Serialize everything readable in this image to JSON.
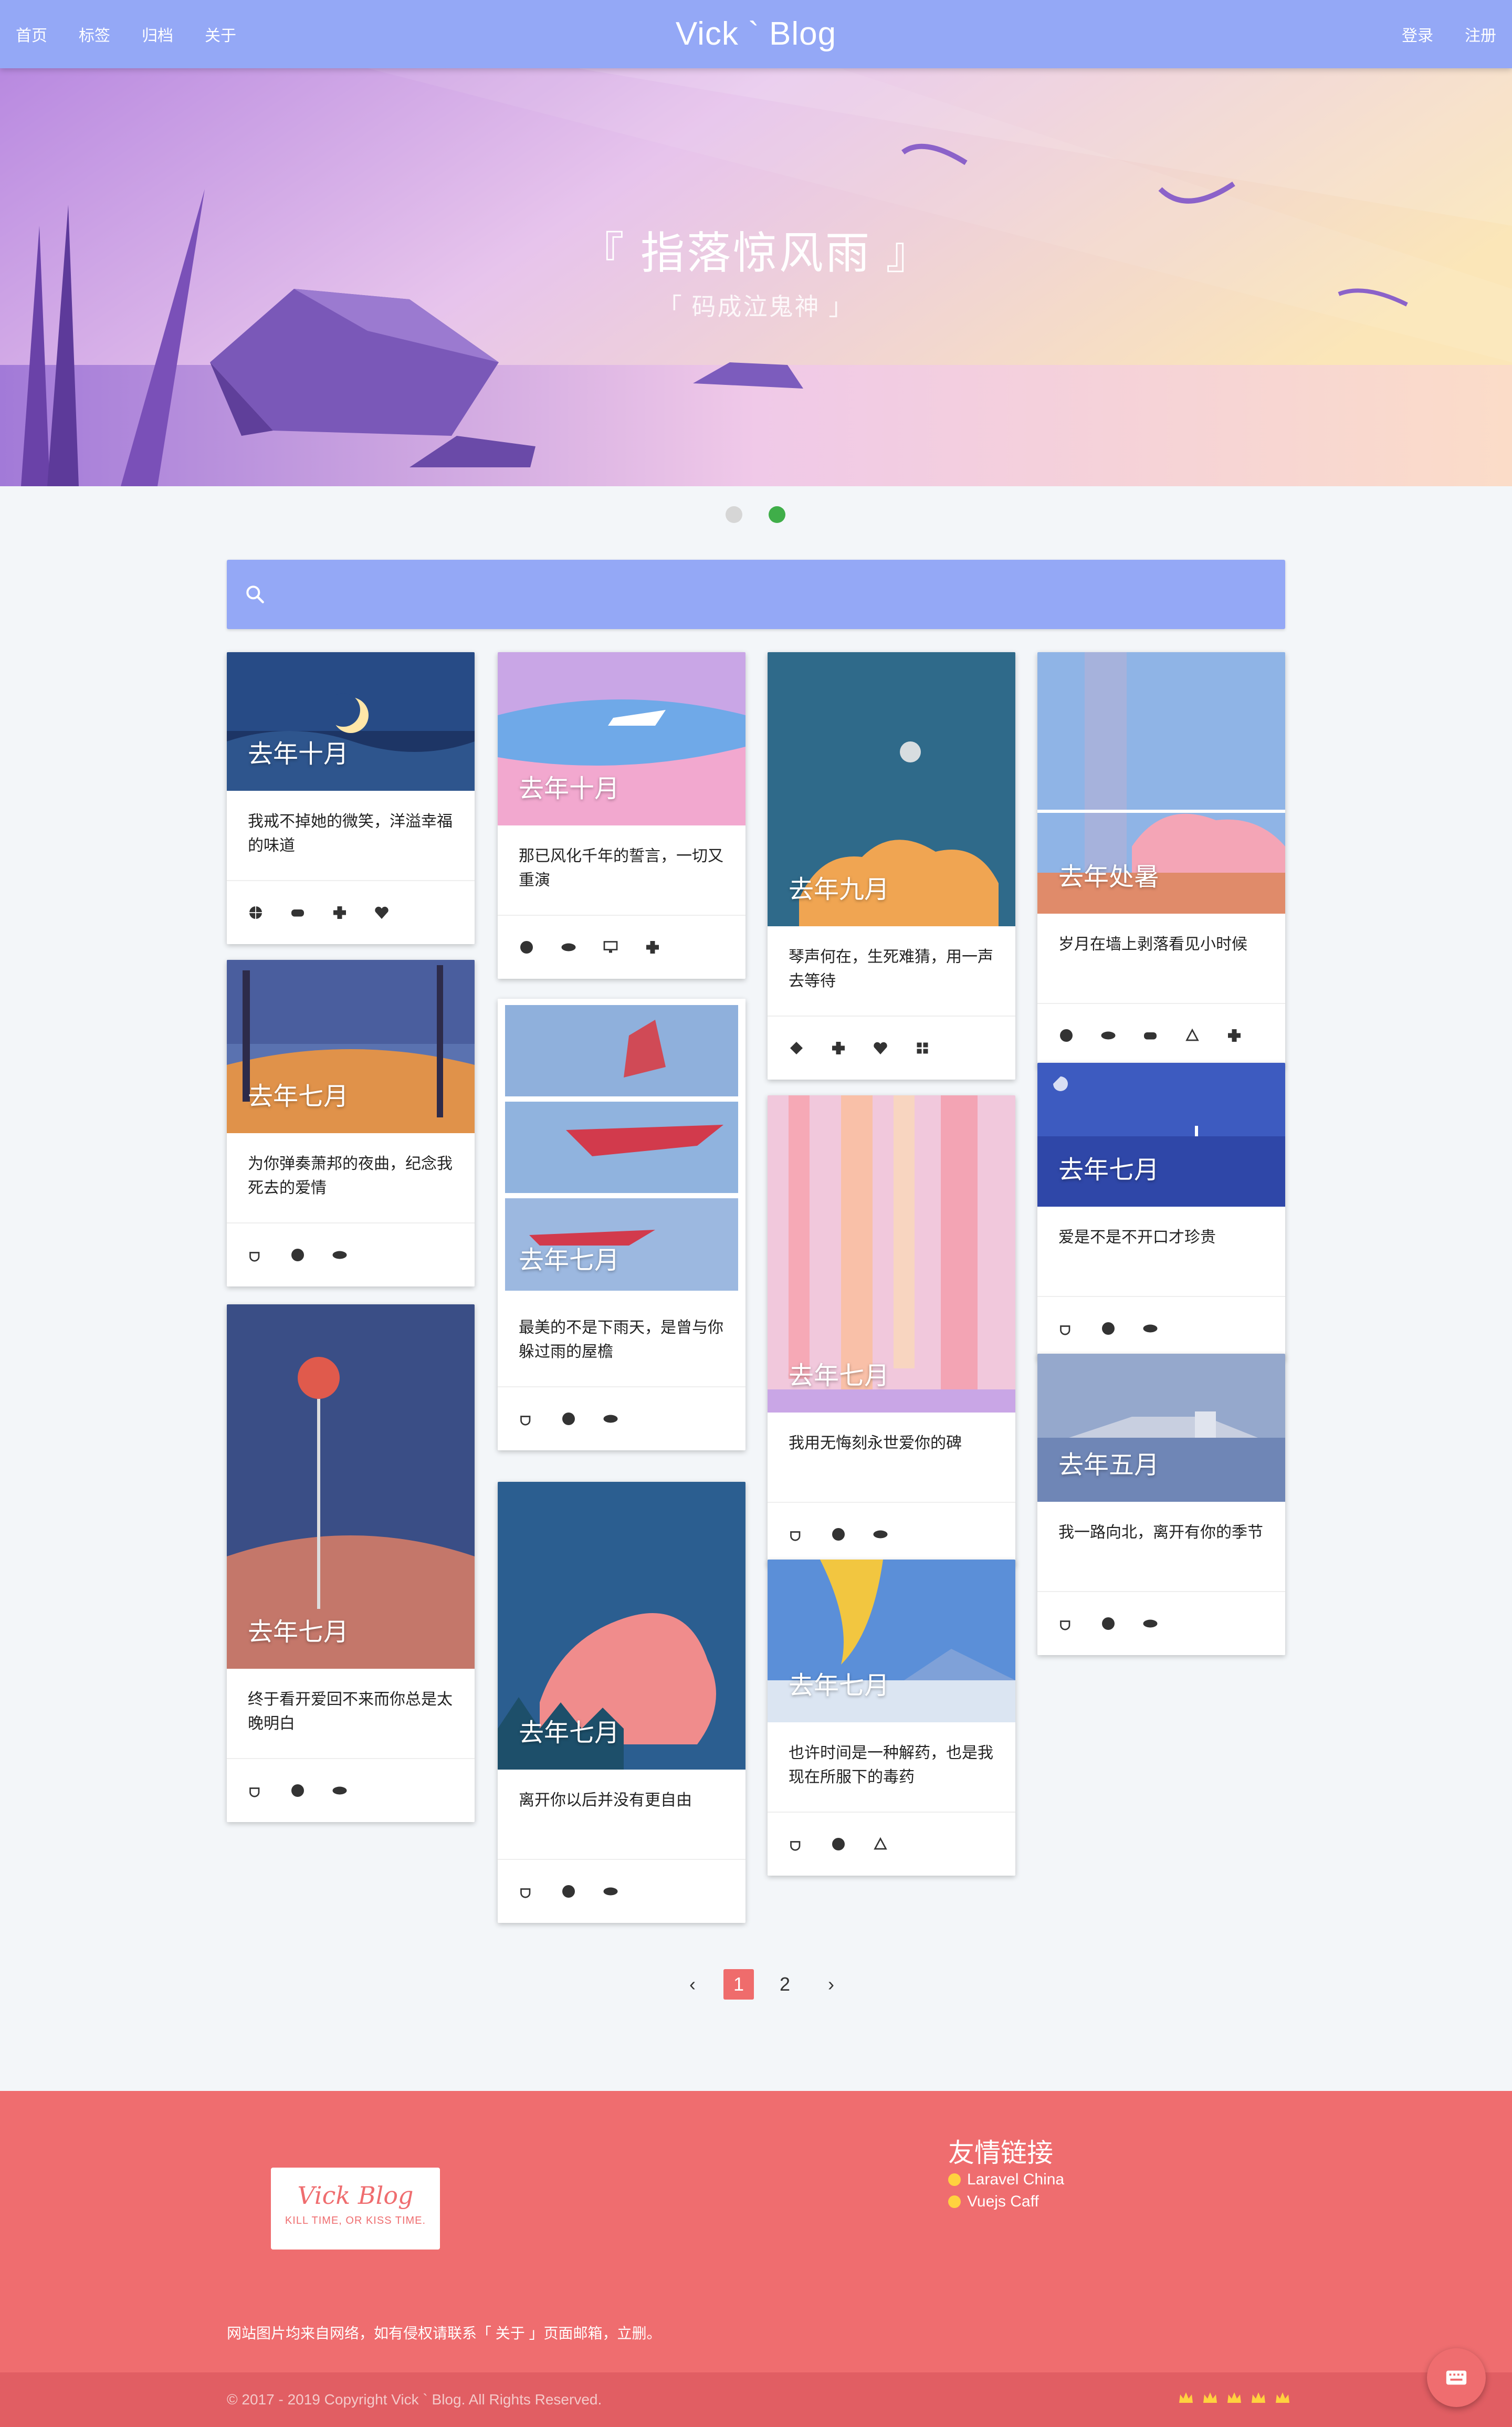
{
  "nav": {
    "links": [
      "首页",
      "标签",
      "归档",
      "关于"
    ],
    "brand": "Vick ` Blog",
    "login": "登录",
    "register": "注册"
  },
  "hero": {
    "title": "『 指落惊风雨 』",
    "subtitle": "「 码成泣鬼神 」",
    "slides": 2,
    "active_slide": 2
  },
  "search": {
    "placeholder": ""
  },
  "cards": [
    {
      "caption": "去年十月",
      "text": "我戒不掉她的微笑，洋溢幸福的味道",
      "icons": [
        "basketball-icon",
        "gamepad-icon",
        "gamepad-cross-icon",
        "heart-icon"
      ]
    },
    {
      "caption": "去年七月",
      "text": "为你弹奏萧邦的夜曲，纪念我死去的爱情",
      "icons": [
        "coffee-icon",
        "basketball-icon",
        "eye-icon"
      ]
    },
    {
      "caption": "去年七月",
      "text": "终于看开爱回不来而你总是太晚明白",
      "icons": [
        "coffee-icon",
        "basketball-icon",
        "eye-icon"
      ]
    },
    {
      "caption": "去年十月",
      "text": "那已风化千年的誓言，一切又重演",
      "icons": [
        "basketball-icon",
        "eye-icon",
        "monitor-icon",
        "gamepad-cross-icon"
      ]
    },
    {
      "caption": "去年七月",
      "text": "最美的不是下雨天，是曾与你躲过雨的屋檐",
      "icons": [
        "coffee-icon",
        "basketball-icon",
        "eye-icon"
      ]
    },
    {
      "caption": "去年七月",
      "text": "离开你以后并没有更自由",
      "icons": [
        "coffee-icon",
        "basketball-icon",
        "eye-icon"
      ]
    },
    {
      "caption": "去年九月",
      "text": "琴声何在，生死难猜，用一声去等待",
      "icons": [
        "diamond-icon",
        "gamepad-cross-icon",
        "heart-icon",
        "windows-icon"
      ]
    },
    {
      "caption": "去年七月",
      "text": "我用无悔刻永世爱你的碑",
      "icons": [
        "coffee-icon",
        "basketball-icon",
        "eye-icon"
      ]
    },
    {
      "caption": "去年七月",
      "text": "也许时间是一种解药，也是我现在所服下的毒药",
      "icons": [
        "coffee-icon",
        "basketball-icon",
        "recycle-icon"
      ]
    },
    {
      "caption": "去年处暑",
      "text": "岁月在墙上剥落看见小时候",
      "icons": [
        "basketball-icon",
        "eye-icon",
        "gamepad-icon",
        "recycle-icon",
        "gamepad-cross-icon"
      ]
    },
    {
      "caption": "去年七月",
      "text": "爱是不是不开口才珍贵",
      "icons": [
        "coffee-icon",
        "basketball-icon",
        "eye-icon"
      ]
    },
    {
      "caption": "去年五月",
      "text": "我一路向北，离开有你的季节",
      "icons": [
        "coffee-icon",
        "basketball-icon",
        "eye-icon"
      ]
    }
  ],
  "pagination": {
    "prev": "‹",
    "pages": [
      "1",
      "2"
    ],
    "current": "1",
    "next": "›"
  },
  "footer": {
    "logo_script": "Vick Blog",
    "logo_tagline": "KILL TIME, OR KISS TIME.",
    "friends_title": "友情链接",
    "friends": [
      "Laravel China",
      "Vuejs Caff"
    ],
    "notice": "网站图片均来自网络，如有侵权请联系「 关于 」页面邮箱，立删。",
    "copyright": "© 2017 - 2019 Copyright Vick ` Blog. All Rights Reserved."
  },
  "colors": {
    "nav": "#94a8f6",
    "footer": "#ef6d6f",
    "active_dot": "#3fae49",
    "active_page": "#ef6c6c"
  }
}
